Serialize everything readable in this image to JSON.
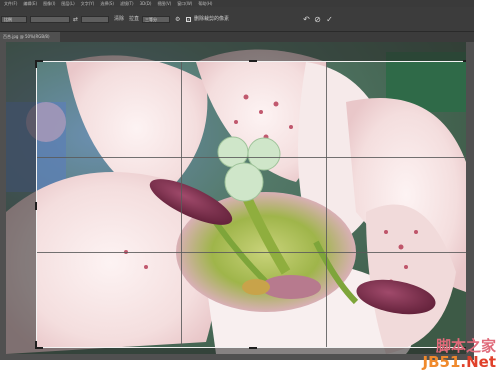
{
  "menu": {
    "items": [
      "文件(F)",
      "编辑(E)",
      "图像(I)",
      "图层(L)",
      "文字(Y)",
      "选择(S)",
      "滤镜(T)",
      "3D(D)",
      "视图(V)",
      "窗口(W)",
      "帮助(H)"
    ]
  },
  "options": {
    "ratio_value": "比例",
    "width_value": "",
    "height_value": "",
    "clear_label": "清除",
    "straighten_label": "拉直",
    "view_value": "三等分",
    "delete_cropped_label": "删除裁剪的像素",
    "delete_cropped_checked": true
  },
  "document": {
    "tab_title": "百合.jpg @ 50%(RGB/8)"
  },
  "watermark": {
    "cn": "脚本之家",
    "site_part1": "JB51",
    "site_part2": ".Net"
  },
  "colors": {
    "accent": "#e06a7a"
  }
}
